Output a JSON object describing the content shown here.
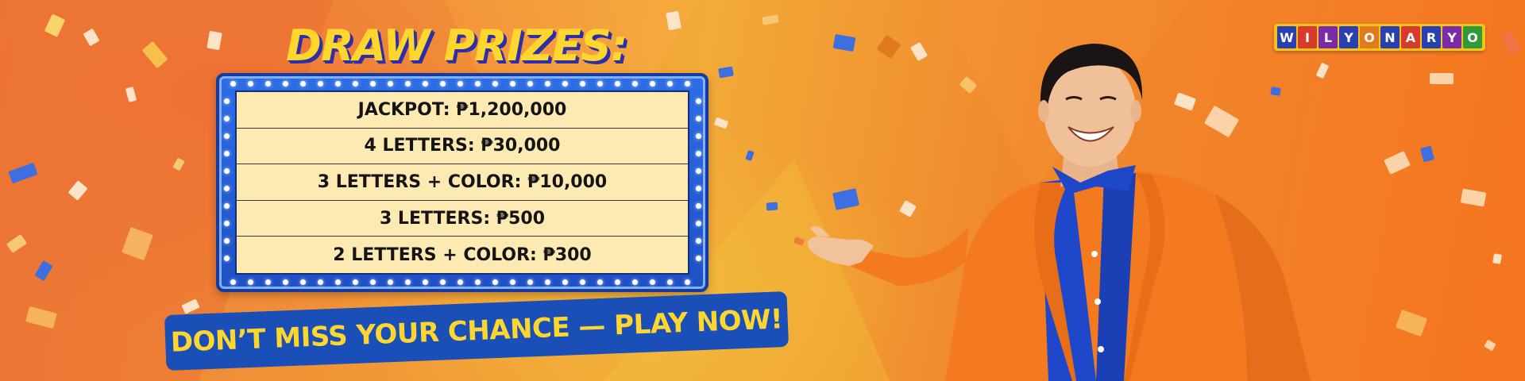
{
  "heading": "DRAW PRIZES:",
  "prizes": [
    "JACKPOT: ₱1,200,000",
    "4 LETTERS: ₱30,000",
    "3 LETTERS + COLOR: ₱10,000",
    "3 LETTERS: ₱500",
    "2 LETTERS + COLOR: ₱300"
  ],
  "cta": "DON’T MISS YOUR CHANCE — PLAY NOW!",
  "logo": {
    "letters": [
      "W",
      "I",
      "L",
      "Y",
      "O",
      "N",
      "A",
      "R",
      "Y",
      "O"
    ],
    "tile_colors": [
      "#2a3fb0",
      "#d83a2c",
      "#7b2aa8",
      "#2a3fb0",
      "#e07a1a",
      "#2a3fb0",
      "#d83a2c",
      "#2a3fb0",
      "#7b2aa8",
      "#2e9a3a"
    ]
  },
  "colors": {
    "accent_yellow": "#ffd62e",
    "board_blue": "#2e6de6",
    "board_fill": "#fdeab3",
    "cta_blue": "#1b4fb8",
    "jacket_orange": "#f47a1f",
    "shirt_blue": "#1f47c9"
  }
}
